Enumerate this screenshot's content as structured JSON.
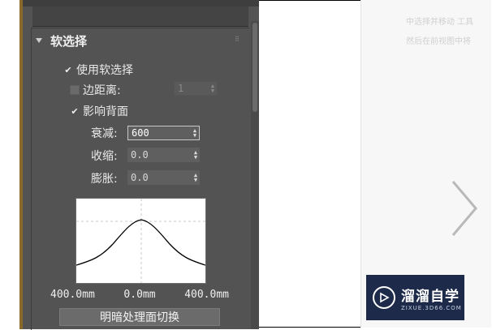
{
  "rollout": {
    "title": "软选择",
    "use_soft_selection": {
      "label": "使用软选择",
      "checked": true
    },
    "edge_distance": {
      "label": "边距离:",
      "checked": false,
      "value": "1"
    },
    "affect_backfacing": {
      "label": "影响背面",
      "checked": true
    },
    "falloff": {
      "label": "衰减:",
      "value": "600"
    },
    "pinch": {
      "label": "收缩:",
      "value": "0.0"
    },
    "bubble": {
      "label": "膨胀:",
      "value": "0.0"
    },
    "curve_axis": {
      "left": "400.0mm",
      "center": "0.0mm",
      "right": "400.0mm"
    },
    "shaded_face_toggle": "明暗处理面切换"
  },
  "right_panel": {
    "hint_line1": "中选择并移动 工具",
    "hint_line2": "然后在前视图中将",
    "logo_cn": "溜溜自学",
    "logo_en": "ZIXUE.3D66.COM"
  },
  "colors": {
    "panel": "#535353",
    "logo_bg": "#1d2a4a"
  },
  "icons": [
    "collapse-triangle-icon",
    "checkmark-icon",
    "spinner-arrows-icon",
    "chevron-right-icon",
    "play-logo-icon"
  ]
}
